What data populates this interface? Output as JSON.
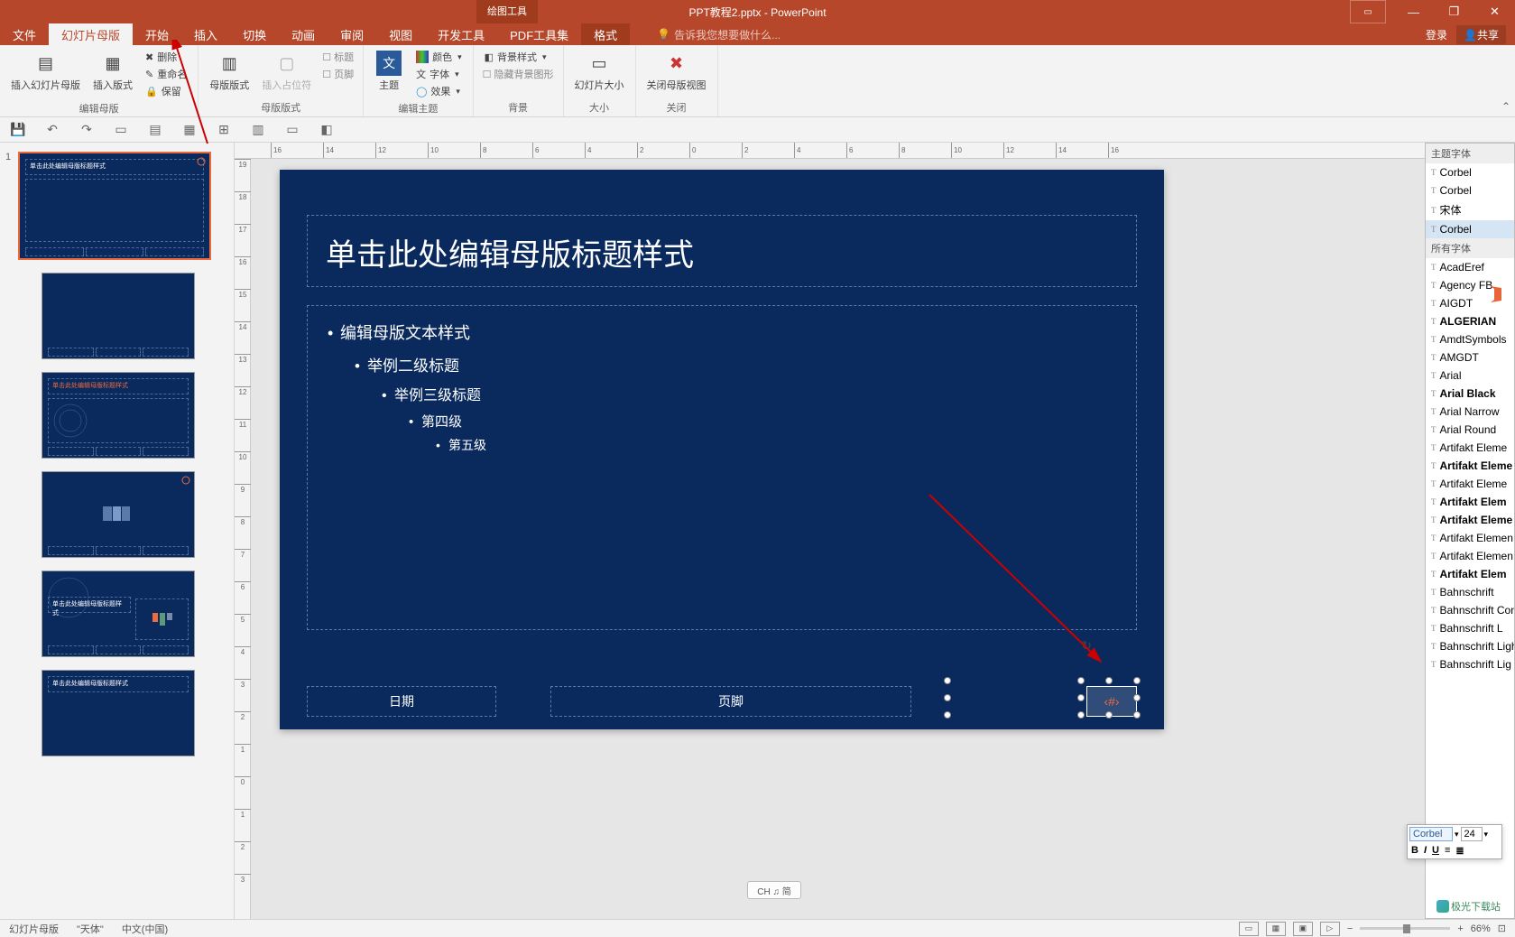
{
  "titlebar": {
    "context_tool": "绘图工具",
    "doc_title": "PPT教程2.pptx - PowerPoint"
  },
  "tabs": {
    "file": "文件",
    "slide_master": "幻灯片母版",
    "home": "开始",
    "insert": "插入",
    "transitions": "切换",
    "animations": "动画",
    "review": "审阅",
    "view": "视图",
    "developer": "开发工具",
    "pdf": "PDF工具集",
    "format": "格式",
    "tell_me": "告诉我您想要做什么...",
    "login": "登录",
    "share": "共享"
  },
  "ribbon": {
    "group_edit_master": "编辑母版",
    "insert_slide_master": "插入幻灯片母版",
    "insert_layout": "插入版式",
    "delete": "删除",
    "rename": "重命名",
    "preserve": "保留",
    "group_master_layout": "母版版式",
    "master_layout": "母版版式",
    "insert_placeholder": "插入占位符",
    "title_cb": "标题",
    "footer_cb": "页脚",
    "group_edit_theme": "编辑主题",
    "themes": "主题",
    "colors": "颜色",
    "fonts": "字体",
    "effects": "效果",
    "group_background": "背景",
    "bg_styles": "背景样式",
    "hide_bg": "隐藏背景图形",
    "group_size": "大小",
    "slide_size": "幻灯片大小",
    "group_close": "关闭",
    "close_master": "关闭母版视图"
  },
  "slide": {
    "title_placeholder": "单击此处编辑母版标题样式",
    "lvl1": "编辑母版文本样式",
    "lvl2": "举例二级标题",
    "lvl3": "举例三级标题",
    "lvl4": "第四级",
    "lvl5": "第五级",
    "date": "日期",
    "footer": "页脚",
    "slide_num": "‹#›"
  },
  "thumb_master_title": "单击此处编辑母版标题样式",
  "thumb_layout2_title": "单击此处编辑母版标题样式",
  "thumb_layout4_title": "单击此处编辑母版标题样式",
  "thumb_layout5_title": "单击此处编辑母版标题样式",
  "font_panel": {
    "theme_fonts_hdr": "主题字体",
    "all_fonts_hdr": "所有字体",
    "theme_list": [
      "Corbel",
      "Corbel",
      "宋体",
      "Corbel"
    ],
    "all_list": [
      "AcadEref",
      "Agency FB",
      "AIGDT",
      "ALGERIAN",
      "AmdtSymbols",
      "AMGDT",
      "Arial",
      "Arial Black",
      "Arial Narrow",
      "Arial Round",
      "Artifakt Eleme",
      "Artifakt Eleme",
      "Artifakt Eleme",
      "Artifakt Elem",
      "Artifakt Eleme",
      "Artifakt Elemen",
      "Artifakt Elemen",
      "Artifakt Elem",
      "Bahnschrift",
      "Bahnschrift Conde",
      "Bahnschrift L",
      "Bahnschrift Light",
      "Bahnschrift Lig"
    ]
  },
  "mini_toolbar": {
    "font_name": "Corbel",
    "font_size": "24",
    "bold": "B",
    "italic": "I",
    "underline": "U"
  },
  "statusbar": {
    "mode": "幻灯片母版",
    "theme": "\"天体\"",
    "lang": "中文(中国)",
    "zoom": "66%",
    "ime": "CH ♫ 简"
  },
  "watermark": "极光下载站",
  "ruler_marks": [
    "16",
    "14",
    "12",
    "10",
    "8",
    "6",
    "4",
    "2",
    "0",
    "2",
    "4",
    "6",
    "8",
    "10",
    "12",
    "14",
    "16"
  ],
  "vruler_marks": [
    "19",
    "18",
    "17",
    "16",
    "15",
    "14",
    "13",
    "12",
    "11",
    "10",
    "9",
    "8",
    "7",
    "6",
    "5",
    "4",
    "3",
    "2",
    "1",
    "0",
    "1",
    "2",
    "3"
  ]
}
